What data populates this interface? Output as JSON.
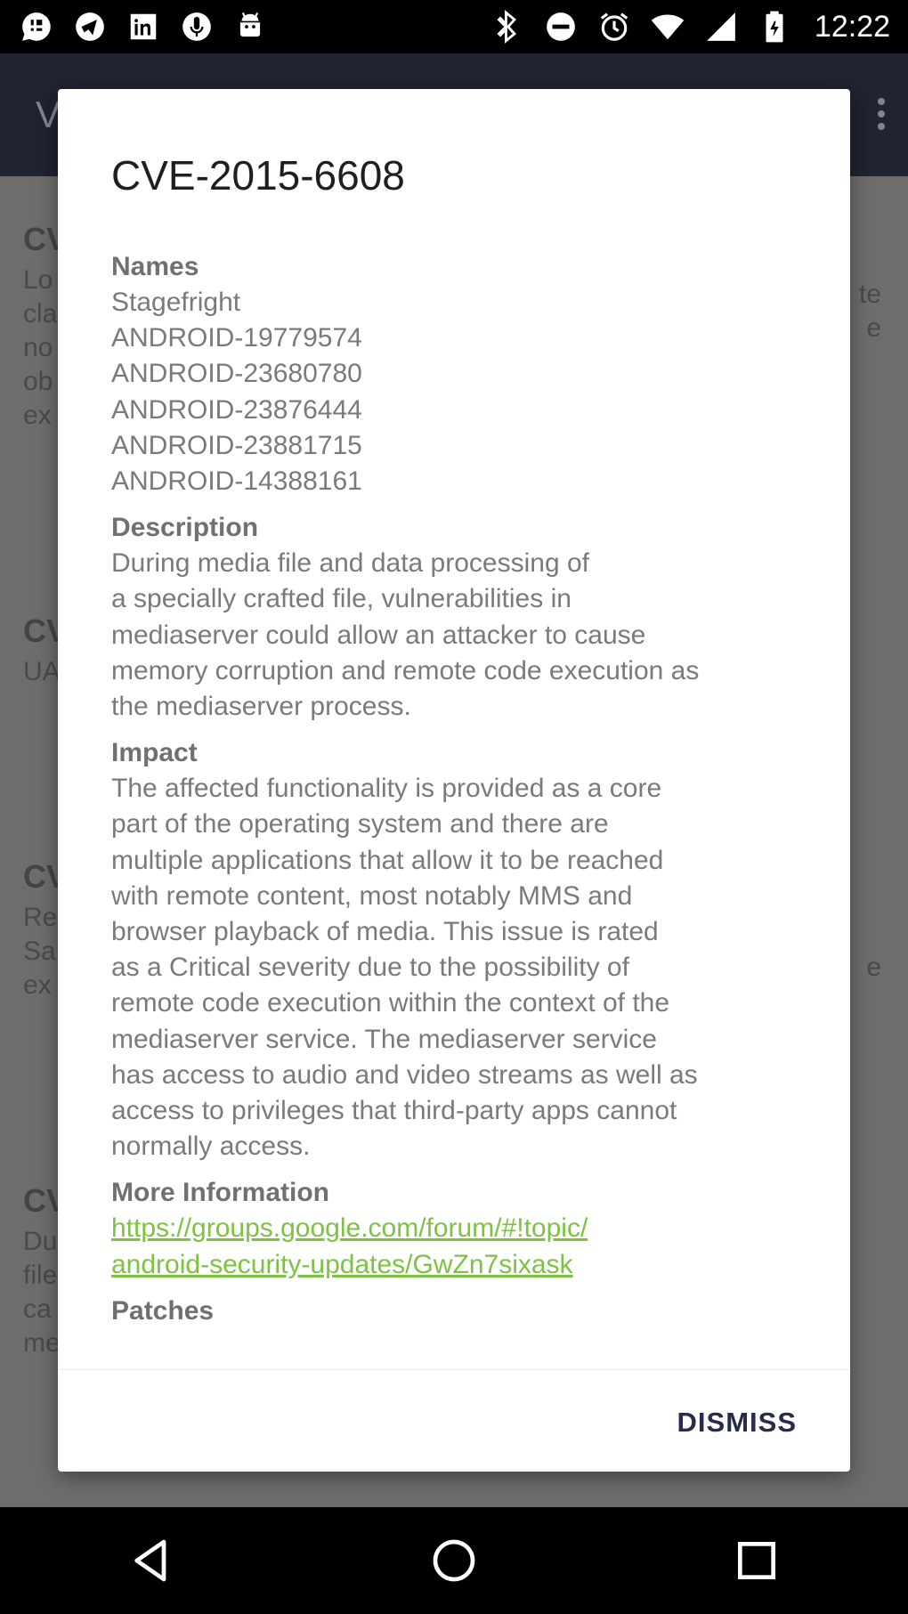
{
  "status_bar": {
    "time": "12:22",
    "left_icons": [
      "chat-icon",
      "telegram-icon",
      "linkedin-icon",
      "microphone-icon",
      "android-icon"
    ],
    "right_icons": [
      "bluetooth-icon",
      "do-not-disturb-icon",
      "alarm-icon",
      "wifi-icon",
      "signal-icon",
      "battery-icon"
    ]
  },
  "app_bar": {
    "title_fragment": "V"
  },
  "background_list": {
    "items": [
      {
        "heading": "CV",
        "lines": [
          "Lo",
          "cla",
          "no",
          "ob",
          "ex"
        ],
        "right_lines": [
          "te",
          "e"
        ]
      },
      {
        "heading": "CV",
        "lines": [
          "UA"
        ],
        "right_lines": []
      },
      {
        "heading": "CV",
        "lines": [
          "Re",
          "Sa",
          "ex"
        ],
        "right_lines": [
          "e"
        ]
      },
      {
        "heading": "CV",
        "lines": [
          "Du",
          "file",
          "ca",
          "me"
        ],
        "right_lines": []
      }
    ]
  },
  "dialog": {
    "title": "CVE-2015-6608",
    "sections": {
      "names": {
        "heading": "Names",
        "items": [
          "Stagefright",
          "ANDROID-19779574",
          "ANDROID-23680780",
          "ANDROID-23876444",
          "ANDROID-23881715",
          "ANDROID-14388161"
        ]
      },
      "description": {
        "heading": "Description",
        "text": "During media file and data processing of\na specially crafted file, vulnerabilities in\nmediaserver could allow an attacker to cause\nmemory corruption and remote code execution as\nthe mediaserver process."
      },
      "impact": {
        "heading": "Impact",
        "text": "The affected functionality is provided as a core\npart of the operating system and there are\nmultiple applications that allow it to be reached\nwith remote content, most notably MMS and\nbrowser playback of media. This issue is rated\nas a Critical severity due to the possibility of\nremote code execution within the context of the\nmediaserver service. The mediaserver service\nhas access to audio and video streams as well as\naccess to privileges that third-party apps cannot\nnormally access."
      },
      "more_information": {
        "heading": "More Information",
        "link": "https://groups.google.com/forum/#!topic/\nandroid-security-updates/GwZn7sixask"
      },
      "patches": {
        "heading": "Patches"
      }
    },
    "dismiss_label": "DISMISS"
  },
  "nav_bar": {
    "icons": [
      "back-icon",
      "home-icon",
      "recents-icon"
    ]
  },
  "colors": {
    "link": "#7dc242",
    "dismiss": "#262c4a",
    "app_bar": "#1f2332",
    "scrim": "#6d6d6d"
  }
}
